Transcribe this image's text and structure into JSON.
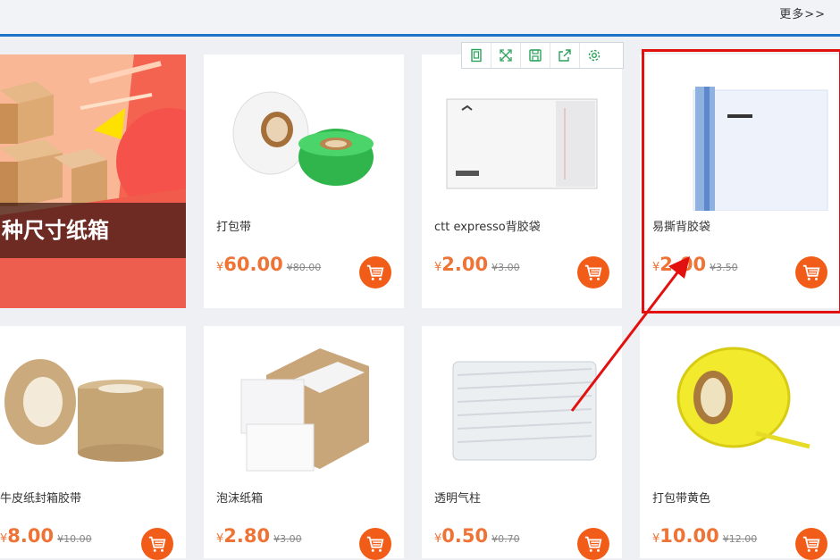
{
  "header": {
    "more_link": "更多>>"
  },
  "banner": {
    "text": "种尺寸纸箱"
  },
  "toolbar": {
    "icons": [
      "page-icon",
      "fullscreen-icon",
      "save-icon",
      "share-icon",
      "settings-icon"
    ]
  },
  "colors": {
    "accent_blue": "#1e73c9",
    "price_orange": "#f07336",
    "cart_orange": "#f25c19",
    "highlight_red": "#e31010"
  },
  "products": [
    {
      "name": "打包带",
      "currency": "¥",
      "price": "60.00",
      "old_price": "¥80.00"
    },
    {
      "name": "ctt expresso背胶袋",
      "currency": "¥",
      "price": "2.00",
      "old_price": "¥3.00"
    },
    {
      "name": "易撕背胶袋",
      "currency": "¥",
      "price": "2.00",
      "old_price": "¥3.50"
    },
    {
      "name": "牛皮纸封箱胶带",
      "currency": "¥",
      "price": "8.00",
      "old_price": "¥10.00"
    },
    {
      "name": "泡沫纸箱",
      "currency": "¥",
      "price": "2.80",
      "old_price": "¥3.00"
    },
    {
      "name": "透明气柱",
      "currency": "¥",
      "price": "0.50",
      "old_price": "¥0.70"
    },
    {
      "name": "打包带黄色",
      "currency": "¥",
      "price": "10.00",
      "old_price": "¥12.00"
    }
  ]
}
